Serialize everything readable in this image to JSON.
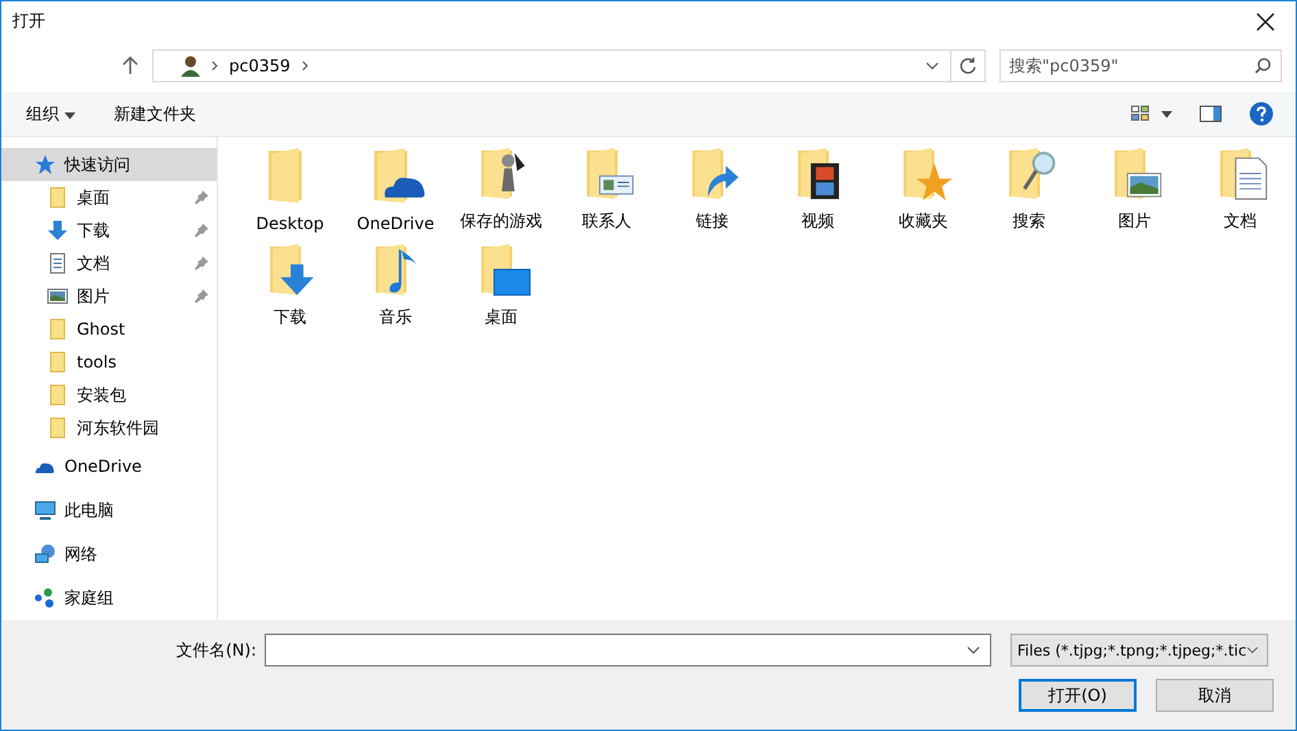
{
  "window": {
    "title": "打开"
  },
  "address": {
    "path": "pc0359",
    "search_placeholder": "搜索\"pc0359\""
  },
  "toolbar": {
    "organize": "组织",
    "new_folder": "新建文件夹"
  },
  "sidebar": {
    "items": [
      {
        "label": "快速访问",
        "kind": "star",
        "selected": true,
        "children": [
          {
            "label": "桌面",
            "kind": "folder",
            "pinned": true,
            "selected": false
          },
          {
            "label": "下载",
            "kind": "download",
            "pinned": true,
            "selected": false
          },
          {
            "label": "文档",
            "kind": "document",
            "pinned": true,
            "selected": false
          },
          {
            "label": "图片",
            "kind": "picture",
            "pinned": true,
            "selected": false
          },
          {
            "label": "Ghost",
            "kind": "folder",
            "pinned": false,
            "selected": false
          },
          {
            "label": "tools",
            "kind": "folder",
            "pinned": false,
            "selected": false
          },
          {
            "label": "安装包",
            "kind": "folder",
            "pinned": false,
            "selected": false
          },
          {
            "label": "河东软件园",
            "kind": "folder",
            "pinned": false,
            "selected": false
          }
        ]
      },
      {
        "label": "OneDrive",
        "kind": "cloud",
        "selected": false
      },
      {
        "label": "此电脑",
        "kind": "computer",
        "selected": false
      },
      {
        "label": "网络",
        "kind": "network",
        "selected": false
      },
      {
        "label": "家庭组",
        "kind": "homegroup",
        "selected": false
      }
    ]
  },
  "files": [
    {
      "name": "Desktop",
      "kind": "plain"
    },
    {
      "name": "OneDrive",
      "kind": "cloud"
    },
    {
      "name": "保存的游戏",
      "kind": "chess"
    },
    {
      "name": "联系人",
      "kind": "contact"
    },
    {
      "name": "链接",
      "kind": "link"
    },
    {
      "name": "视频",
      "kind": "film"
    },
    {
      "name": "收藏夹",
      "kind": "star"
    },
    {
      "name": "搜索",
      "kind": "search"
    },
    {
      "name": "图片",
      "kind": "picture"
    },
    {
      "name": "文档",
      "kind": "document"
    },
    {
      "name": "下载",
      "kind": "download"
    },
    {
      "name": "音乐",
      "kind": "music"
    },
    {
      "name": "桌面",
      "kind": "screen"
    }
  ],
  "footer": {
    "filename_label": "文件名(N):",
    "file_type": "Files (*.tjpg;*.tpng;*.tjpeg;*.tic",
    "open_button": "打开(O)",
    "cancel_button": "取消"
  }
}
